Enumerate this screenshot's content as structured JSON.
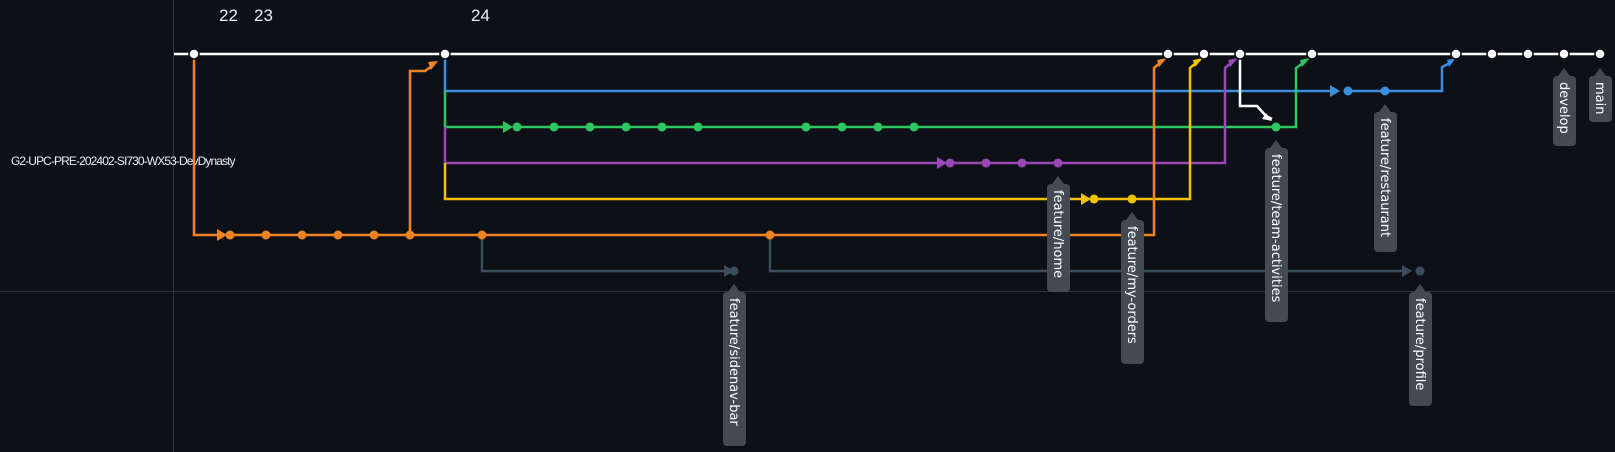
{
  "repository": {
    "name": "G2-UPC-PRE-202402-SI730-WX53-DevDynasty"
  },
  "timeline": {
    "dates": [
      "22",
      "23",
      "24"
    ]
  },
  "colors": {
    "background": "#0d1117",
    "main": "#ffffff",
    "feature_restaurant": "#3b8fdc",
    "feature_team_activities": "#2ec45f",
    "feature_home": "#9b47b8",
    "feature_my_orders": "#f2c200",
    "develop_branch_line": "#f08424",
    "sidenav_profile": "#3c4d5e",
    "tag_background": "#434a54"
  },
  "branches": [
    {
      "name": "main",
      "color": "#ffffff"
    },
    {
      "name": "develop",
      "color": "#ffffff"
    },
    {
      "name": "feature/restaurant",
      "color": "#3b8fdc"
    },
    {
      "name": "feature/team-activities",
      "color": "#2ec45f"
    },
    {
      "name": "feature/home",
      "color": "#9b47b8"
    },
    {
      "name": "feature/my-orders",
      "color": "#f2c200"
    },
    {
      "name": "feature/sidenav-bar",
      "color": "#3c4d5e"
    },
    {
      "name": "feature/profile",
      "color": "#3c4d5e"
    }
  ]
}
